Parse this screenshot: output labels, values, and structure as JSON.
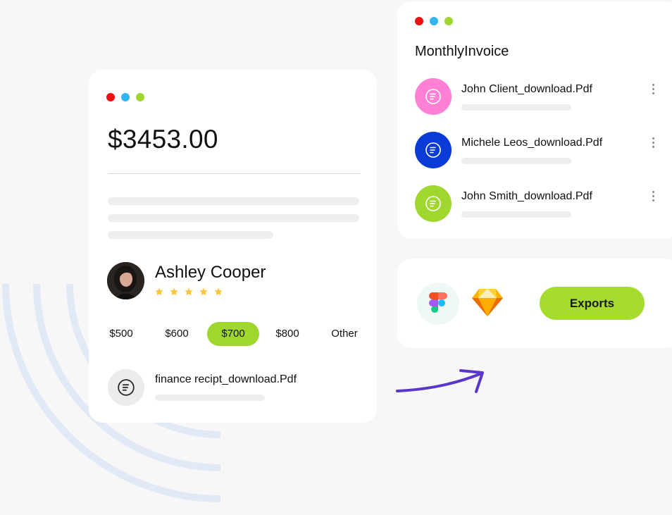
{
  "window_dots": [
    "#ee1010",
    "#33b5f0",
    "#9fd72f"
  ],
  "payment": {
    "amount": "$3453.00",
    "person": {
      "name": "Ashley Cooper",
      "rating": 5,
      "star_color": "#ffc23d"
    },
    "amount_options": [
      {
        "label": "$500",
        "selected": false
      },
      {
        "label": "$600",
        "selected": false
      },
      {
        "label": "$700",
        "selected": true
      },
      {
        "label": "$800",
        "selected": false
      },
      {
        "label": "Other",
        "selected": false
      }
    ],
    "selected_color": "#9fd72f",
    "file": {
      "name": "finance recipt_download.Pdf",
      "icon": "file-doc-icon"
    }
  },
  "invoice": {
    "title": "MonthlyInvoice",
    "items": [
      {
        "name": "John Client_download.Pdf",
        "icon_bg": "#ff80d4",
        "icon": "file-doc-icon"
      },
      {
        "name": "Michele Leos_download.Pdf",
        "icon_bg": "#0a3bd6",
        "icon": "file-doc-icon"
      },
      {
        "name": "John Smith_download.Pdf",
        "icon_bg": "#9fd72f",
        "icon": "file-doc-icon"
      }
    ]
  },
  "export": {
    "tools": [
      "figma-icon",
      "sketch-icon"
    ],
    "button_label": "Exports",
    "button_color": "#a5dc2e"
  },
  "accent_arrow_color": "#5a36c9"
}
